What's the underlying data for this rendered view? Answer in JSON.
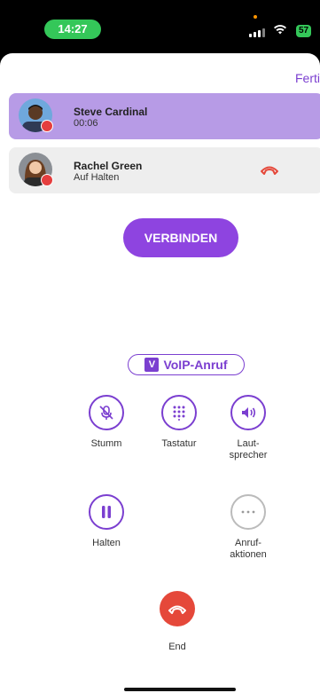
{
  "status_bar": {
    "time": "14:27",
    "battery": "57"
  },
  "header": {
    "done_label": "Ferti"
  },
  "calls": [
    {
      "name": "Steve Cardinal",
      "status": "00:06"
    },
    {
      "name": "Rachel Green",
      "status": "Auf Halten"
    }
  ],
  "merge_label": "VERBINDEN",
  "voip": {
    "badge_letter": "V",
    "label": "VoIP-Anruf"
  },
  "controls": {
    "mute": "Stumm",
    "keypad": "Tastatur",
    "speaker": "Laut-\nsprecher",
    "hold": "Halten",
    "actions": "Anruf-\naktionen"
  },
  "end_label": "End",
  "colors": {
    "accent": "#7b3fd0",
    "active_row": "#b79be6",
    "end": "#e5483a",
    "status_green": "#34c759"
  }
}
